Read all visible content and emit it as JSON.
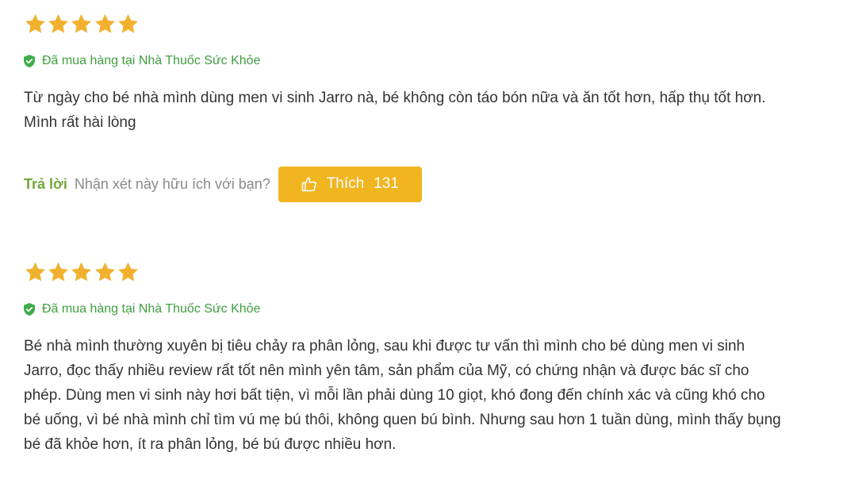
{
  "colors": {
    "star": "#f1b12f",
    "verified": "#3f9f3f",
    "reply": "#72a73a",
    "like_button": "#f1b520"
  },
  "reviews": [
    {
      "rating": 5,
      "rating_max": 5,
      "verified_text": "Đã mua hàng tại Nhà Thuốc Sức Khỏe",
      "body": "Từ ngày cho bé nhà mình dùng men vi sinh Jarro nà, bé không còn táo bón nữa và ăn tốt hơn, hấp thụ tốt hơn. Mình rất hài lòng",
      "reply_label": "Trả lời",
      "helpful_question": "Nhận xét này hữu ích với bạn?",
      "like_label": "Thích",
      "like_count": "131"
    },
    {
      "rating": 5,
      "rating_max": 5,
      "verified_text": "Đã mua hàng tại Nhà Thuốc Sức Khỏe",
      "body": "Bé nhà mình thường xuyên bị tiêu chảy ra phân lỏng, sau khi được tư vấn thì mình cho bé dùng men vi sinh Jarro, đọc thấy nhiều review rất tốt nên mình yên tâm, sản phẩm của Mỹ, có chứng nhận và được bác sĩ cho phép. Dùng men vi sinh này hơi bất tiện, vì mỗi lần phải dùng 10 giọt, khó đong đến chính xác và cũng khó cho bé uống, vì bé nhà mình chỉ tìm vú mẹ bú thôi, không quen bú bình. Nhưng sau hơn 1 tuần dùng, mình thấy bụng bé đã khỏe hơn, ít ra phân lỏng, bé bú được nhiều hơn."
    }
  ]
}
